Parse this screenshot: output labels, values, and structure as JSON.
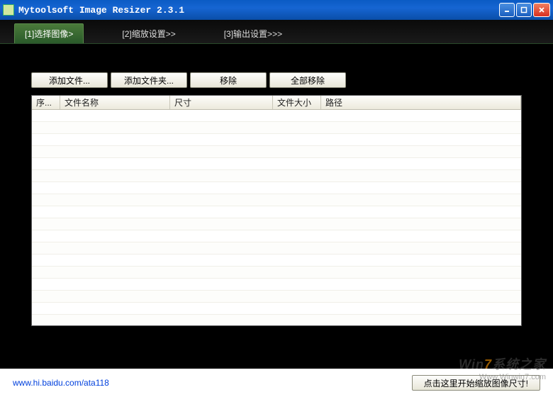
{
  "window": {
    "title": "Mytoolsoft Image Resizer 2.3.1"
  },
  "tabs": {
    "t1": "[1]选择图像>",
    "t2": "[2]缩放设置>>",
    "t3": "[3]输出设置>>>"
  },
  "toolbar": {
    "add_file": "添加文件...",
    "add_folder": "添加文件夹...",
    "remove": "移除",
    "remove_all": "全部移除"
  },
  "table": {
    "headers": {
      "index": "序...",
      "filename": "文件名称",
      "size": "尺寸",
      "filesize": "文件大小",
      "path": "路径"
    }
  },
  "footer": {
    "link": "www.hi.baidu.com/ata118",
    "start": "点击这里开始缩放图像尺寸!"
  },
  "watermark": {
    "line1_prefix": "Win",
    "line1_seven": "7",
    "line1_suffix": "系统之家",
    "line2": "Www.Winwin7.com"
  }
}
